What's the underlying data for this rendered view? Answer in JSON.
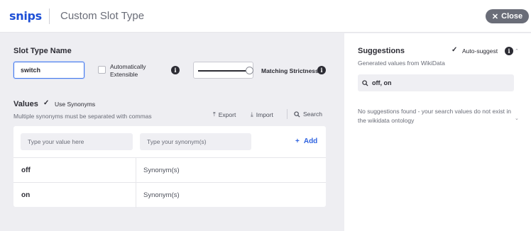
{
  "header": {
    "logo": "snips",
    "title": "Custom Slot Type",
    "close_label": "Close"
  },
  "slot": {
    "section_title": "Slot Type Name",
    "name_value": "switch",
    "auto_extensible_line1": "Automatically",
    "auto_extensible_line2": "Extensible",
    "auto_extensible_checked": false,
    "matching_strictness_label": "Matching Strictness",
    "matching_strictness_level": 1.0
  },
  "values": {
    "section_title": "Values",
    "use_synonyms_label": "Use Synonyms",
    "use_synonyms_checked": true,
    "hint": "Multiple synonyms must be separated with commas",
    "toolbar": {
      "export_label": "Export",
      "import_label": "Import",
      "search_label": "Search"
    },
    "value_placeholder": "Type your value here",
    "synonym_placeholder": "Type your synonym(s)",
    "add_label": "Add",
    "rows": [
      {
        "value": "off",
        "synonyms": "Synonym(s)"
      },
      {
        "value": "on",
        "synonyms": "Synonym(s)"
      }
    ]
  },
  "suggestions": {
    "title": "Suggestions",
    "auto_suggest_label": "Auto-suggest",
    "auto_suggest_checked": true,
    "subtitle": "Generated values from WikiData",
    "search_value": "off, on",
    "empty_message": "No suggestions found - your search values do not exist in the wikidata ontology"
  },
  "colors": {
    "brand": "#1d4fd6",
    "accent": "#2f63e0",
    "close_bg": "#6a6d78"
  }
}
